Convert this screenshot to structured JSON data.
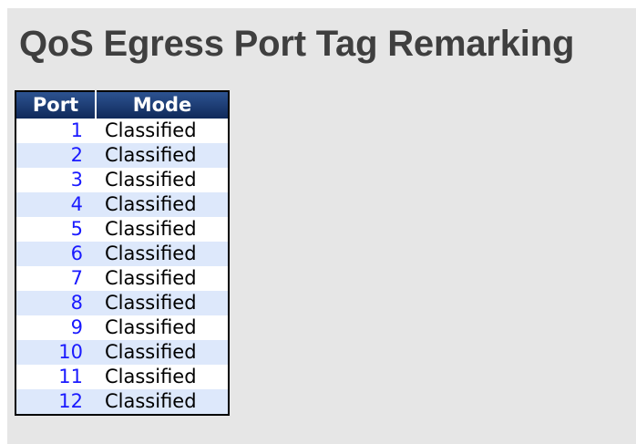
{
  "page": {
    "title": "QoS Egress Port Tag Remarking"
  },
  "table": {
    "headers": {
      "port": "Port",
      "mode": "Mode"
    },
    "rows": [
      {
        "port": "1",
        "mode": "Classified"
      },
      {
        "port": "2",
        "mode": "Classified"
      },
      {
        "port": "3",
        "mode": "Classified"
      },
      {
        "port": "4",
        "mode": "Classified"
      },
      {
        "port": "5",
        "mode": "Classified"
      },
      {
        "port": "6",
        "mode": "Classified"
      },
      {
        "port": "7",
        "mode": "Classified"
      },
      {
        "port": "8",
        "mode": "Classified"
      },
      {
        "port": "9",
        "mode": "Classified"
      },
      {
        "port": "10",
        "mode": "Classified"
      },
      {
        "port": "11",
        "mode": "Classified"
      },
      {
        "port": "12",
        "mode": "Classified"
      }
    ]
  },
  "colors": {
    "header_bg": "#1a3a6b",
    "row_alt_bg": "#dde8fb",
    "link": "#1a1aff",
    "panel_bg": "#e6e6e6"
  }
}
